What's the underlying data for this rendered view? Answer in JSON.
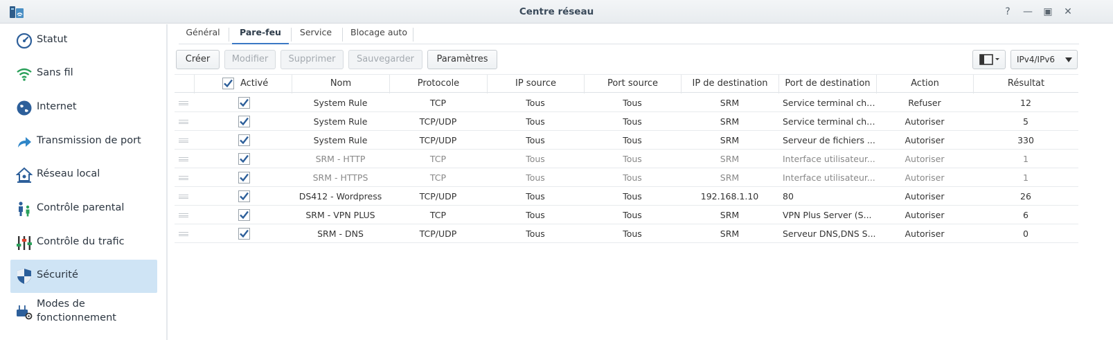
{
  "window": {
    "title": "Centre réseau",
    "controls": [
      "?",
      "—",
      "▣",
      "✕"
    ]
  },
  "sidebar": {
    "items": [
      {
        "label": "Statut",
        "icon": "gauge-icon",
        "active": false
      },
      {
        "label": "Sans fil",
        "icon": "wifi-icon",
        "active": false
      },
      {
        "label": "Internet",
        "icon": "globe-icon",
        "active": false
      },
      {
        "label": "Transmission de port",
        "icon": "forward-arrow-icon",
        "active": false
      },
      {
        "label": "Réseau local",
        "icon": "home-network-icon",
        "active": false
      },
      {
        "label": "Contrôle parental",
        "icon": "parent-child-icon",
        "active": false
      },
      {
        "label": "Contrôle du trafic",
        "icon": "equalizer-icon",
        "active": false
      },
      {
        "label": "Sécurité",
        "icon": "shield-icon",
        "active": true
      },
      {
        "label": "Modes de fonctionnement",
        "icon": "router-gear-icon",
        "active": false
      }
    ]
  },
  "tabs": [
    {
      "label": "Général",
      "active": false
    },
    {
      "label": "Pare-feu",
      "active": true
    },
    {
      "label": "Service",
      "active": false
    },
    {
      "label": "Blocage auto",
      "active": false
    }
  ],
  "toolbar": {
    "buttons": [
      {
        "label": "Créer",
        "enabled": true
      },
      {
        "label": "Modifier",
        "enabled": false
      },
      {
        "label": "Supprimer",
        "enabled": false
      },
      {
        "label": "Sauvegarder",
        "enabled": false
      },
      {
        "label": "Paramètres",
        "enabled": true
      }
    ],
    "view_menu_icon": "layout-icon",
    "ip_version": "IPv4/IPv6"
  },
  "table": {
    "columns": [
      "Activé",
      "Nom",
      "Protocole",
      "IP source",
      "Port source",
      "IP de destination",
      "Port de destination",
      "Action",
      "Résultat"
    ],
    "header_checked": true,
    "rows": [
      {
        "enabled": true,
        "name": "System Rule",
        "protocol": "TCP",
        "src_ip": "Tous",
        "src_port": "Tous",
        "dst_ip": "SRM",
        "dst_port": "Service terminal chi...",
        "action": "Refuser",
        "result": "12",
        "dim": false
      },
      {
        "enabled": true,
        "name": "System Rule",
        "protocol": "TCP/UDP",
        "src_ip": "Tous",
        "src_port": "Tous",
        "dst_ip": "SRM",
        "dst_port": "Service terminal chi...",
        "action": "Autoriser",
        "result": "5",
        "dim": false
      },
      {
        "enabled": true,
        "name": "System Rule",
        "protocol": "TCP/UDP",
        "src_ip": "Tous",
        "src_port": "Tous",
        "dst_ip": "SRM",
        "dst_port": "Serveur de fichiers ...",
        "action": "Autoriser",
        "result": "330",
        "dim": false
      },
      {
        "enabled": true,
        "name": "SRM - HTTP",
        "protocol": "TCP",
        "src_ip": "Tous",
        "src_port": "Tous",
        "dst_ip": "SRM",
        "dst_port": "Interface utilisateur...",
        "action": "Autoriser",
        "result": "1",
        "dim": true
      },
      {
        "enabled": true,
        "name": "SRM - HTTPS",
        "protocol": "TCP",
        "src_ip": "Tous",
        "src_port": "Tous",
        "dst_ip": "SRM",
        "dst_port": "Interface utilisateur...",
        "action": "Autoriser",
        "result": "1",
        "dim": true
      },
      {
        "enabled": true,
        "name": "DS412 - Wordpress",
        "protocol": "TCP/UDP",
        "src_ip": "Tous",
        "src_port": "Tous",
        "dst_ip": "192.168.1.10",
        "dst_port": "80",
        "action": "Autoriser",
        "result": "26",
        "dim": false
      },
      {
        "enabled": true,
        "name": "SRM - VPN PLUS",
        "protocol": "TCP",
        "src_ip": "Tous",
        "src_port": "Tous",
        "dst_ip": "SRM",
        "dst_port": "VPN Plus Server (S...",
        "action": "Autoriser",
        "result": "6",
        "dim": false
      },
      {
        "enabled": true,
        "name": "SRM - DNS",
        "protocol": "TCP/UDP",
        "src_ip": "Tous",
        "src_port": "Tous",
        "dst_ip": "SRM",
        "dst_port": "Serveur DNS,DNS S...",
        "action": "Autoriser",
        "result": "0",
        "dim": false
      }
    ]
  },
  "colors": {
    "accent": "#3b78c4",
    "checkmark": "#2d5f9a",
    "active_nav_bg": "#cfe4f5"
  }
}
